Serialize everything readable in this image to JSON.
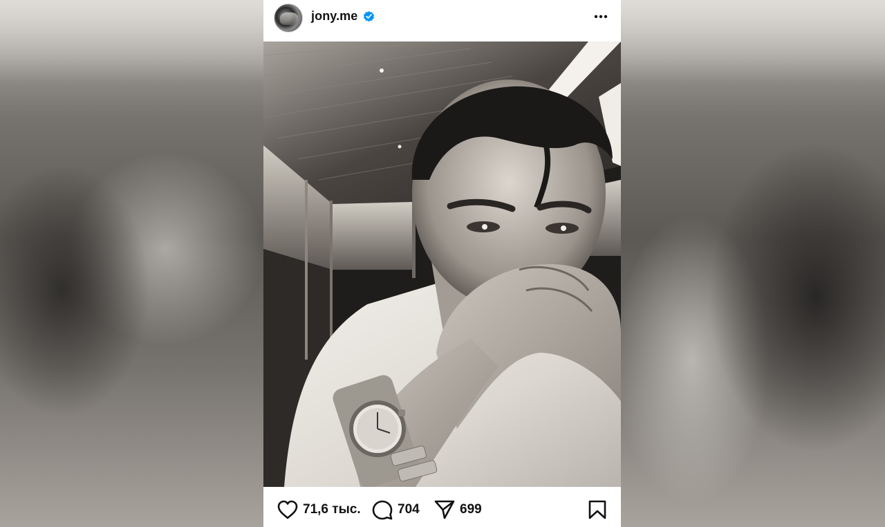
{
  "post": {
    "username": "jony.me",
    "verified": true,
    "avatar_icon": "profile-avatar",
    "more_icon": "more-horizontal-icon"
  },
  "photo": {
    "icon": "post-photo",
    "tone": "black-and-white"
  },
  "actions": {
    "likes": "71,6 тыс.",
    "comments": "704",
    "shares": "699",
    "like_icon": "heart-icon",
    "comment_icon": "comment-bubble-icon",
    "share_icon": "send-icon",
    "save_icon": "bookmark-icon"
  },
  "colors": {
    "verified_badge": "#0095f6",
    "text": "#111111",
    "card_background": "#ffffff"
  }
}
